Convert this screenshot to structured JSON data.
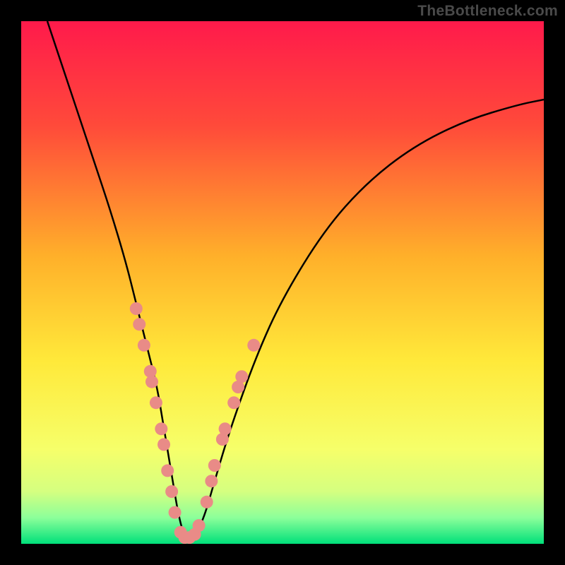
{
  "watermark": "TheBottleneck.com",
  "chart_data": {
    "type": "line",
    "title": "",
    "xlabel": "",
    "ylabel": "",
    "xlim": [
      0,
      100
    ],
    "ylim": [
      0,
      100
    ],
    "background_gradient": {
      "stops": [
        {
          "offset": 0,
          "color": "#ff1a4b"
        },
        {
          "offset": 20,
          "color": "#ff4a3a"
        },
        {
          "offset": 45,
          "color": "#ffb02a"
        },
        {
          "offset": 65,
          "color": "#ffe93a"
        },
        {
          "offset": 82,
          "color": "#f6ff6a"
        },
        {
          "offset": 90,
          "color": "#d5ff80"
        },
        {
          "offset": 95,
          "color": "#8cff9a"
        },
        {
          "offset": 100,
          "color": "#00e07a"
        }
      ]
    },
    "series": [
      {
        "name": "bottleneck-curve",
        "color": "#000000",
        "x": [
          5,
          8,
          11,
          14,
          17,
          20,
          22,
          24,
          26,
          27,
          28,
          29,
          30,
          31,
          32,
          33,
          35,
          37,
          40,
          45,
          50,
          58,
          66,
          75,
          85,
          95,
          100
        ],
        "y": [
          100,
          91,
          82,
          73,
          64,
          54,
          46,
          38,
          30,
          24,
          18,
          12,
          6,
          2,
          0,
          1,
          5,
          12,
          22,
          36,
          47,
          60,
          69,
          76,
          81,
          84,
          85
        ]
      }
    ],
    "marker_points": {
      "name": "highlight-dots",
      "color": "#e98b87",
      "radius": 9,
      "points": [
        {
          "x": 22.0,
          "y": 45
        },
        {
          "x": 22.6,
          "y": 42
        },
        {
          "x": 23.5,
          "y": 38
        },
        {
          "x": 24.7,
          "y": 33
        },
        {
          "x": 25.0,
          "y": 31
        },
        {
          "x": 25.8,
          "y": 27
        },
        {
          "x": 26.8,
          "y": 22
        },
        {
          "x": 27.3,
          "y": 19
        },
        {
          "x": 28.0,
          "y": 14
        },
        {
          "x": 28.8,
          "y": 10
        },
        {
          "x": 29.4,
          "y": 6
        },
        {
          "x": 30.5,
          "y": 2.2
        },
        {
          "x": 31.3,
          "y": 1.2
        },
        {
          "x": 32.2,
          "y": 1.2
        },
        {
          "x": 33.2,
          "y": 1.8
        },
        {
          "x": 34.0,
          "y": 3.5
        },
        {
          "x": 35.5,
          "y": 8
        },
        {
          "x": 36.4,
          "y": 12
        },
        {
          "x": 37.0,
          "y": 15
        },
        {
          "x": 38.5,
          "y": 20
        },
        {
          "x": 39.0,
          "y": 22
        },
        {
          "x": 40.7,
          "y": 27
        },
        {
          "x": 41.5,
          "y": 30
        },
        {
          "x": 42.2,
          "y": 32
        },
        {
          "x": 44.5,
          "y": 38
        }
      ]
    }
  }
}
